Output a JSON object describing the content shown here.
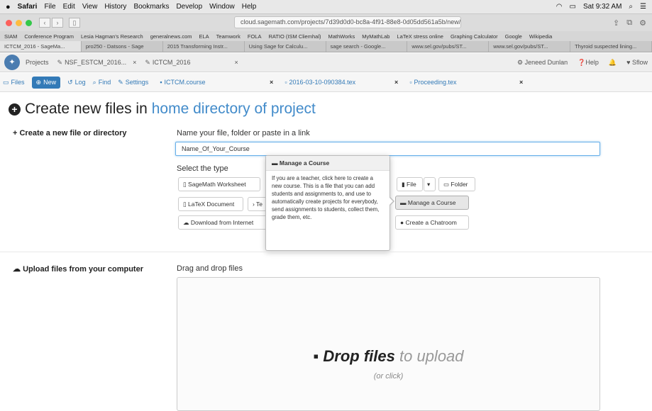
{
  "menubar": {
    "apple": "",
    "app": "Safari",
    "items": [
      "File",
      "Edit",
      "View",
      "History",
      "Bookmarks",
      "Develop",
      "Window",
      "Help"
    ],
    "status": "Sat 9:32 AM"
  },
  "browser": {
    "url": "cloud.sagemath.com/projects/7d39d0d0-bc8a-4f91-88e8-0d05dd561a5b/new/",
    "favorites": [
      "SIAM",
      "Conference Program",
      "Lesia Hagman's Research",
      "generalnews.com",
      "ELA",
      "Teamwork",
      "FOLA",
      "RATIO (ISM Cliemhal)",
      "MathWorks",
      "MyMathLab",
      "LaTeX stress online",
      "Graphing Calculator",
      "Google",
      "Wikipedia"
    ],
    "tabs": [
      "ICTCM_2016 - SageMa...",
      "pro250 - Datsons - Sage",
      "2015 Transforming Instr...",
      "Using Sage for Calculu...",
      "sage search - Google...",
      "www.sel.gov/pubs/ST...",
      "www.sel.gov/pubs/ST...",
      "Thyroid suspected lining..."
    ]
  },
  "topnav": {
    "projects": "Projects",
    "tab1": "NSF_ESTCM_2016...",
    "tab2": "ICTCM_2016",
    "user": "Jeneed Dunlan",
    "help": "Help",
    "account": "Sflow"
  },
  "projbar": {
    "files": "Files",
    "new": "New",
    "log": "Log",
    "find": "Find",
    "settings": "Settings",
    "file_tabs": [
      "ICTCM.course",
      "2016-03-10-090384.tex",
      "Proceeding.tex"
    ]
  },
  "main": {
    "title_prefix": "Create new files in",
    "title_link": "home directory of project",
    "create_section": "Create a new file or directory",
    "name_label": "Name your file, folder or paste in a link",
    "name_value": "Name_Of_Your_Course",
    "type_label": "Select the type",
    "buttons": {
      "sagemath": "SageMath Worksheet",
      "latex": "LaTeX Document",
      "terminal": "Te",
      "download": "Download from Internet",
      "file": "File",
      "folder": "Folder",
      "course": "Manage a Course",
      "chat": "Create a Chatroom"
    },
    "popover": {
      "title": "Manage a Course",
      "body": "If you are a teacher, click here to create a new course. This is a file that you can add students and assignments to, and use to automatically create projects for everybody, send assignments to students, collect them, grade them, etc."
    },
    "upload_section": "Upload files from your computer",
    "drag_label": "Drag and drop files",
    "drop_bold": "Drop files",
    "drop_light": "to upload",
    "drop_sub": "(or click)"
  }
}
